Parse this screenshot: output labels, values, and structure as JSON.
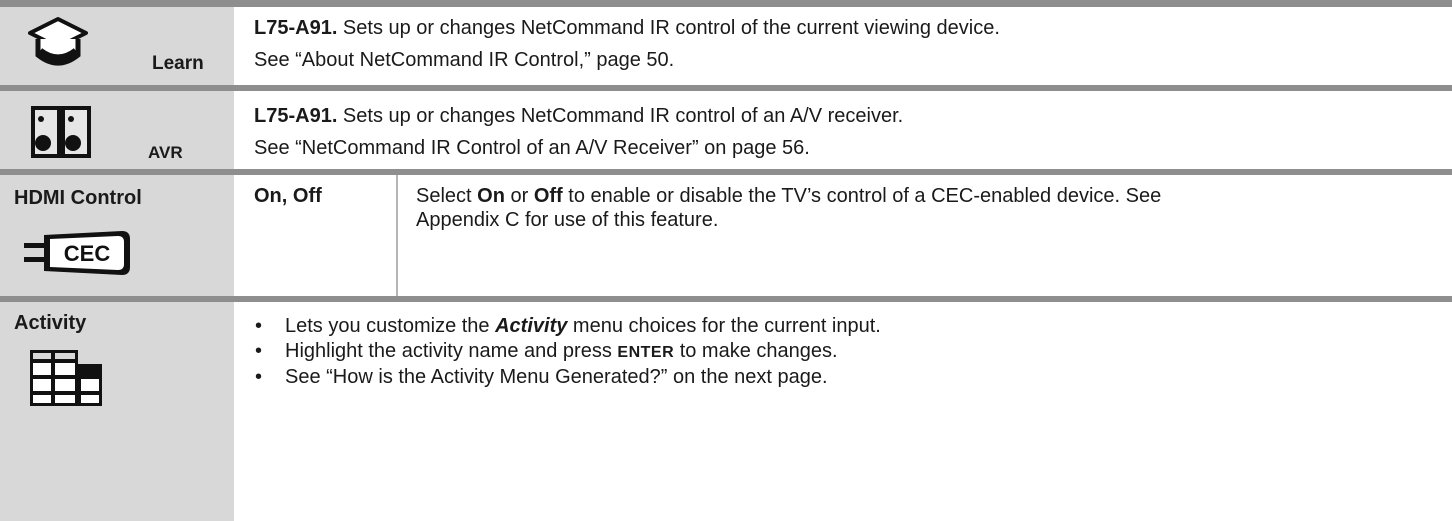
{
  "rows": {
    "learn": {
      "icon_label": "Learn",
      "icon": "graduation-cap-icon",
      "code": "L75-A91.",
      "line1_rest": " Sets up or changes NetCommand IR control of the current viewing device.",
      "line2": "See “About NetCommand IR Control,” page 50."
    },
    "avr": {
      "icon_label": "AVR",
      "icon": "speakers-icon",
      "code": "L75-A91.",
      "line1_rest": " Sets up or changes NetCommand IR control of an A/V receiver.",
      "line2": "See “NetCommand IR Control of an A/V Receiver” on page 56."
    },
    "hdmi": {
      "label": "HDMI Control",
      "icon": "cec-plug-icon",
      "icon_text": "CEC",
      "values": "On, Off",
      "desc_pre": "Select ",
      "desc_on": "On",
      "desc_mid": " or ",
      "desc_off": "Off",
      "desc_line1_rest": " to enable or disable the TV’s control of a CEC-enabled device.  See",
      "desc_line2": "Appendix C for use of this feature."
    },
    "activity": {
      "label": "Activity",
      "icon": "grid-menu-icon",
      "bullet": "•",
      "b1_pre": "Lets you customize the ",
      "b1_em": "Activity",
      "b1_post": " menu choices for the current input.",
      "b2_pre": "Highlight the activity name and press ",
      "b2_key": "ENTER",
      "b2_post": " to make changes.",
      "b3": "See “How is the Activity Menu Generated?” on the next page."
    }
  },
  "colors": {
    "left_column": "#d8d8d8",
    "rule": "#8e8e8e",
    "separator": "#b5b5b5"
  }
}
